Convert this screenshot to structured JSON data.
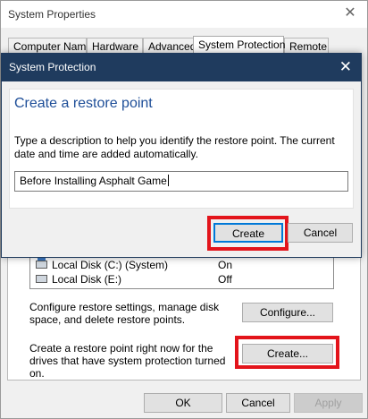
{
  "window": {
    "title": "System Properties",
    "close_glyph": "✕",
    "tabs": [
      {
        "label": "Computer Name"
      },
      {
        "label": "Hardware"
      },
      {
        "label": "Advanced"
      },
      {
        "label": "System Protection"
      },
      {
        "label": "Remote"
      }
    ],
    "active_tab": "System Protection"
  },
  "drives": [
    {
      "name": "Local Disk (C:) (System)",
      "protection": "On",
      "icon": "system-drive-icon"
    },
    {
      "name": "Local Disk (E:)",
      "protection": "Off",
      "icon": "drive-icon"
    }
  ],
  "configure": {
    "description": "Configure restore settings, manage disk space, and delete restore points.",
    "button": "Configure..."
  },
  "create_section": {
    "description": "Create a restore point right now for the drives that have system protection turned on.",
    "button": "Create..."
  },
  "footer": {
    "ok": "OK",
    "cancel": "Cancel",
    "apply": "Apply"
  },
  "dialog": {
    "title": "System Protection",
    "close_glyph": "✕",
    "heading": "Create a restore point",
    "instructions": "Type a description to help you identify the restore point. The current date and time are added automatically.",
    "input_value": "Before Installing Asphalt Game",
    "create_button": "Create",
    "cancel_button": "Cancel"
  },
  "colors": {
    "dialog_titlebar": "#1f3b5e",
    "heading_blue": "#1e4e98",
    "highlight_red": "#e3141b"
  }
}
